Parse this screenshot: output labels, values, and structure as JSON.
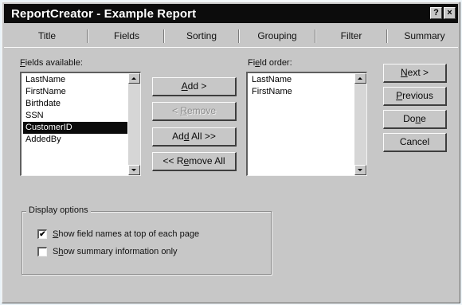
{
  "window": {
    "title": "ReportCreator - Example Report",
    "help_glyph": "?",
    "close_glyph": "×"
  },
  "tabs": [
    {
      "label": "Title"
    },
    {
      "label": "Fields"
    },
    {
      "label": "Sorting"
    },
    {
      "label": "Grouping"
    },
    {
      "label": "Filter"
    },
    {
      "label": "Summary"
    }
  ],
  "fields_available": {
    "label_mnemonic": "F",
    "label_rest": "ields available:",
    "items": [
      "LastName",
      "FirstName",
      "Birthdate",
      "SSN",
      "CustomerID",
      "AddedBy"
    ],
    "selected_index": 4
  },
  "field_order": {
    "label_pre": "Fi",
    "label_mnemonic": "e",
    "label_rest": "ld order:",
    "items": [
      "LastName",
      "FirstName"
    ]
  },
  "middle_buttons": {
    "add_mnemonic": "A",
    "add_rest": "dd >",
    "remove_pre": "< ",
    "remove_mnemonic": "R",
    "remove_rest": "emove",
    "add_all_pre": "Ad",
    "add_all_mnemonic": "d",
    "add_all_rest": " All >>",
    "remove_all_pre": "<< R",
    "remove_all_mnemonic": "e",
    "remove_all_rest": "move All"
  },
  "right_buttons": {
    "next_mnemonic": "N",
    "next_rest": "ext >",
    "previous_mnemonic": "P",
    "previous_rest": "revious",
    "done_pre": "Do",
    "done_mnemonic": "n",
    "done_rest": "e",
    "cancel": "Cancel"
  },
  "display_options": {
    "title": "Display options",
    "show_field_names_mnemonic": "S",
    "show_field_names_rest": "how field names at top of each page",
    "show_field_names_checked": true,
    "show_summary_pre": "S",
    "show_summary_mnemonic": "h",
    "show_summary_rest": "ow summary information only",
    "show_summary_checked": false,
    "check_glyph": "✔"
  }
}
